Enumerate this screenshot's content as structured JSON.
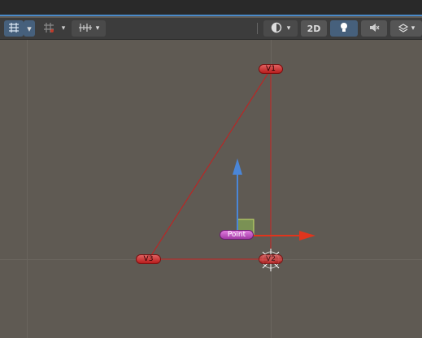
{
  "toolbar": {
    "mode_2d_label": "2D",
    "tools": [
      {
        "name": "transform-snap",
        "icon": "snap-grid-icon",
        "active": true
      },
      {
        "name": "grid-snap",
        "icon": "grid-snap-icon",
        "active": false
      },
      {
        "name": "increment-snap",
        "icon": "ruler-icon",
        "active": false
      }
    ],
    "right_tools": [
      "shading-mode-icon",
      "2d-toggle",
      "lighting-icon",
      "audio-mute-icon",
      "effects-icon"
    ]
  },
  "scene": {
    "vertices": [
      {
        "label": "V1"
      },
      {
        "label": "V2"
      },
      {
        "label": "V3"
      }
    ],
    "point_label": "Point",
    "colors": {
      "edge": "#c81e1e",
      "y_axis": "#4a86d8",
      "x_axis": "#e0351d",
      "handle": "#8fbf55"
    }
  }
}
